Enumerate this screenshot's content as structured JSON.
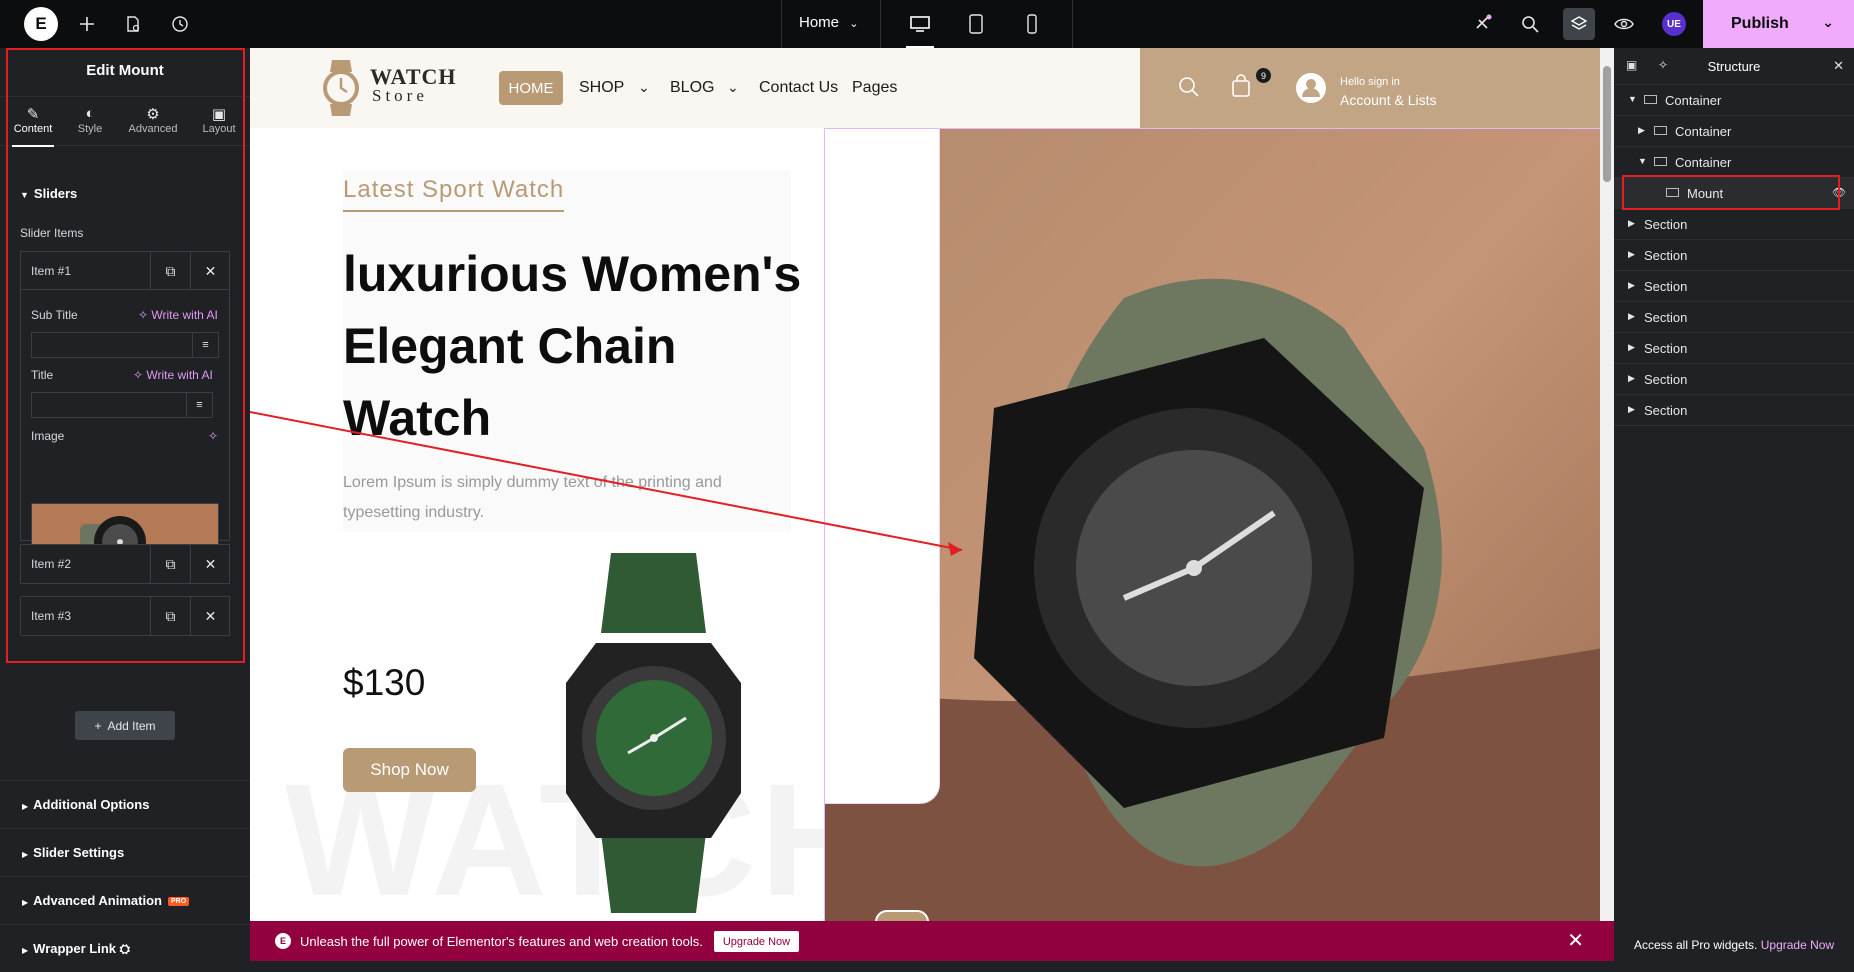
{
  "topbar": {
    "logo": "E",
    "page_name": "Home",
    "user_badge": "UE",
    "publish_label": "Publish"
  },
  "left_panel": {
    "title": "Edit Mount",
    "tabs": [
      {
        "label": "Content",
        "icon": "pencil-icon"
      },
      {
        "label": "Style",
        "icon": "contrast-icon"
      },
      {
        "label": "Advanced",
        "icon": "gear-icon"
      },
      {
        "label": "Layout",
        "icon": "layout-icon"
      }
    ],
    "section": "Sliders",
    "slider_items_label": "Slider Items",
    "items": [
      {
        "label": "Item #1"
      },
      {
        "label": "Item #2"
      },
      {
        "label": "Item #3"
      }
    ],
    "fields": {
      "sub_title_label": "Sub Title",
      "title_label": "Title",
      "image_label": "Image",
      "write_ai": "Write with AI",
      "sub_title_value": "",
      "title_value": ""
    },
    "add_item_label": "Add Item",
    "groups": [
      {
        "label": "Additional Options"
      },
      {
        "label": "Slider Settings"
      },
      {
        "label": "Advanced Animation",
        "badge": "PRO"
      },
      {
        "label": "Wrapper Link"
      }
    ]
  },
  "site": {
    "logo_line1": "WATCH",
    "logo_line2": "Store",
    "nav": [
      "HOME",
      "SHOP",
      "BLOG",
      "Contact Us",
      "Pages"
    ],
    "cart_count": "9",
    "hello": "Hello sign in",
    "account": "Account & Lists",
    "subtitle": "Latest Sport Watch",
    "headline": "luxurious Women's Elegant Chain Watch",
    "lorem": "Lorem Ipsum is simply dummy text of the printing and typesetting industry.",
    "price": "$130",
    "shop_now": "Shop Now",
    "watermark": "WATCH"
  },
  "promo": {
    "message": "Unleash the full power of Elementor's features and web creation tools.",
    "upgrade": "Upgrade Now"
  },
  "right_panel": {
    "title": "Structure",
    "tree": [
      {
        "label": "Container",
        "level": 0,
        "expanded": true
      },
      {
        "label": "Container",
        "level": 1,
        "expanded": false
      },
      {
        "label": "Container",
        "level": 1,
        "expanded": true
      },
      {
        "label": "Mount",
        "level": 2,
        "selected": true
      },
      {
        "label": "Section",
        "level": 0
      },
      {
        "label": "Section",
        "level": 0
      },
      {
        "label": "Section",
        "level": 0
      },
      {
        "label": "Section",
        "level": 0
      },
      {
        "label": "Section",
        "level": 0
      },
      {
        "label": "Section",
        "level": 0
      },
      {
        "label": "Section",
        "level": 0
      }
    ],
    "footer": "Access all Pro widgets.",
    "footer_link": "Upgrade Now"
  },
  "colors": {
    "accent_pink": "#f0abfc",
    "brand_tan": "#b89a74",
    "promo_bg": "#93003f",
    "highlight_red": "#e31e24"
  }
}
